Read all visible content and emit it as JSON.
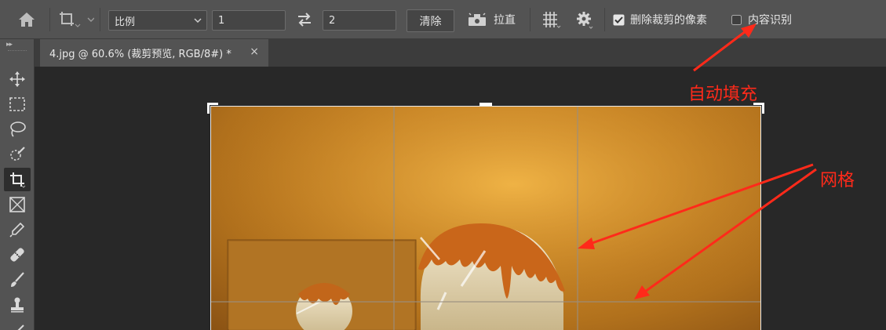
{
  "options_bar": {
    "ratio_select": "比例",
    "ratio_width": "1",
    "ratio_height": "2",
    "clear_label": "清除",
    "straighten_label": "拉直",
    "delete_cropped_label": "删除裁剪的像素",
    "delete_cropped_checked": true,
    "content_aware_label": "内容识别",
    "content_aware_checked": false
  },
  "document_tab": {
    "title": "4.jpg @ 60.6% (裁剪预览, RGB/8#) *",
    "close_glyph": "×"
  },
  "annotations": {
    "auto_fill": "自动填充",
    "grid": "网格"
  },
  "colors": {
    "accent_annotation": "#ff2a1a",
    "panel": "#535353",
    "canvas_bg": "#282828"
  }
}
